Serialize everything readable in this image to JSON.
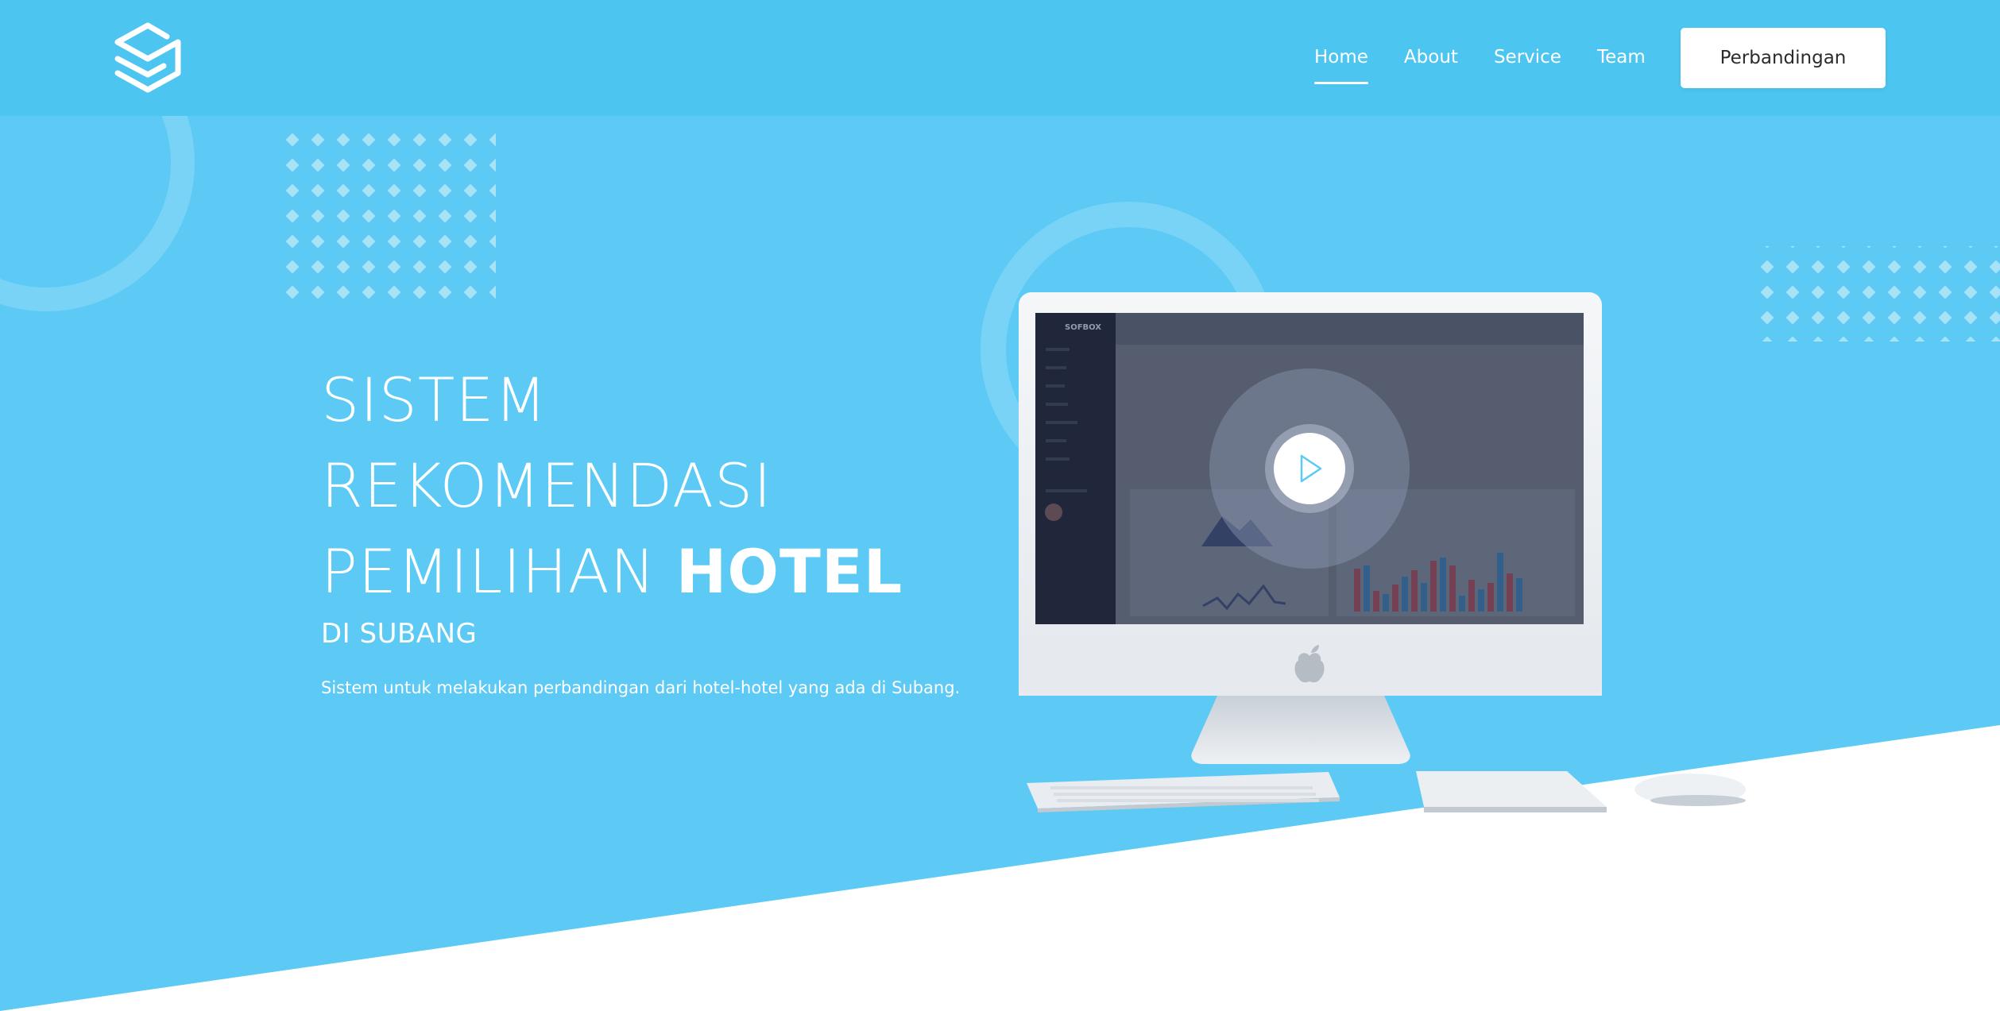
{
  "brand": {
    "logo_icon": "cube-logo-icon"
  },
  "nav": {
    "links": [
      {
        "label": "Home",
        "active": true
      },
      {
        "label": "About",
        "active": false
      },
      {
        "label": "Service",
        "active": false
      },
      {
        "label": "Team",
        "active": false
      }
    ],
    "cta_label": "Perbandingan"
  },
  "hero": {
    "title_line1": "SISTEM",
    "title_line2": "REKOMENDASI",
    "title_line3_light": "PEMILIHAN",
    "title_line3_bold": "HOTEL",
    "subtitle": "DI SUBANG",
    "description": "Sistem untuk melakukan perbandingan dari hotel-hotel yang ada di Subang."
  },
  "screen": {
    "app_name": "SOFBOX",
    "play_icon": "play-icon"
  },
  "colors": {
    "navbar": "#4cc5f1",
    "hero": "#5ccaf5",
    "accent_white": "#ffffff",
    "screen_overlay": "#4c5470"
  }
}
